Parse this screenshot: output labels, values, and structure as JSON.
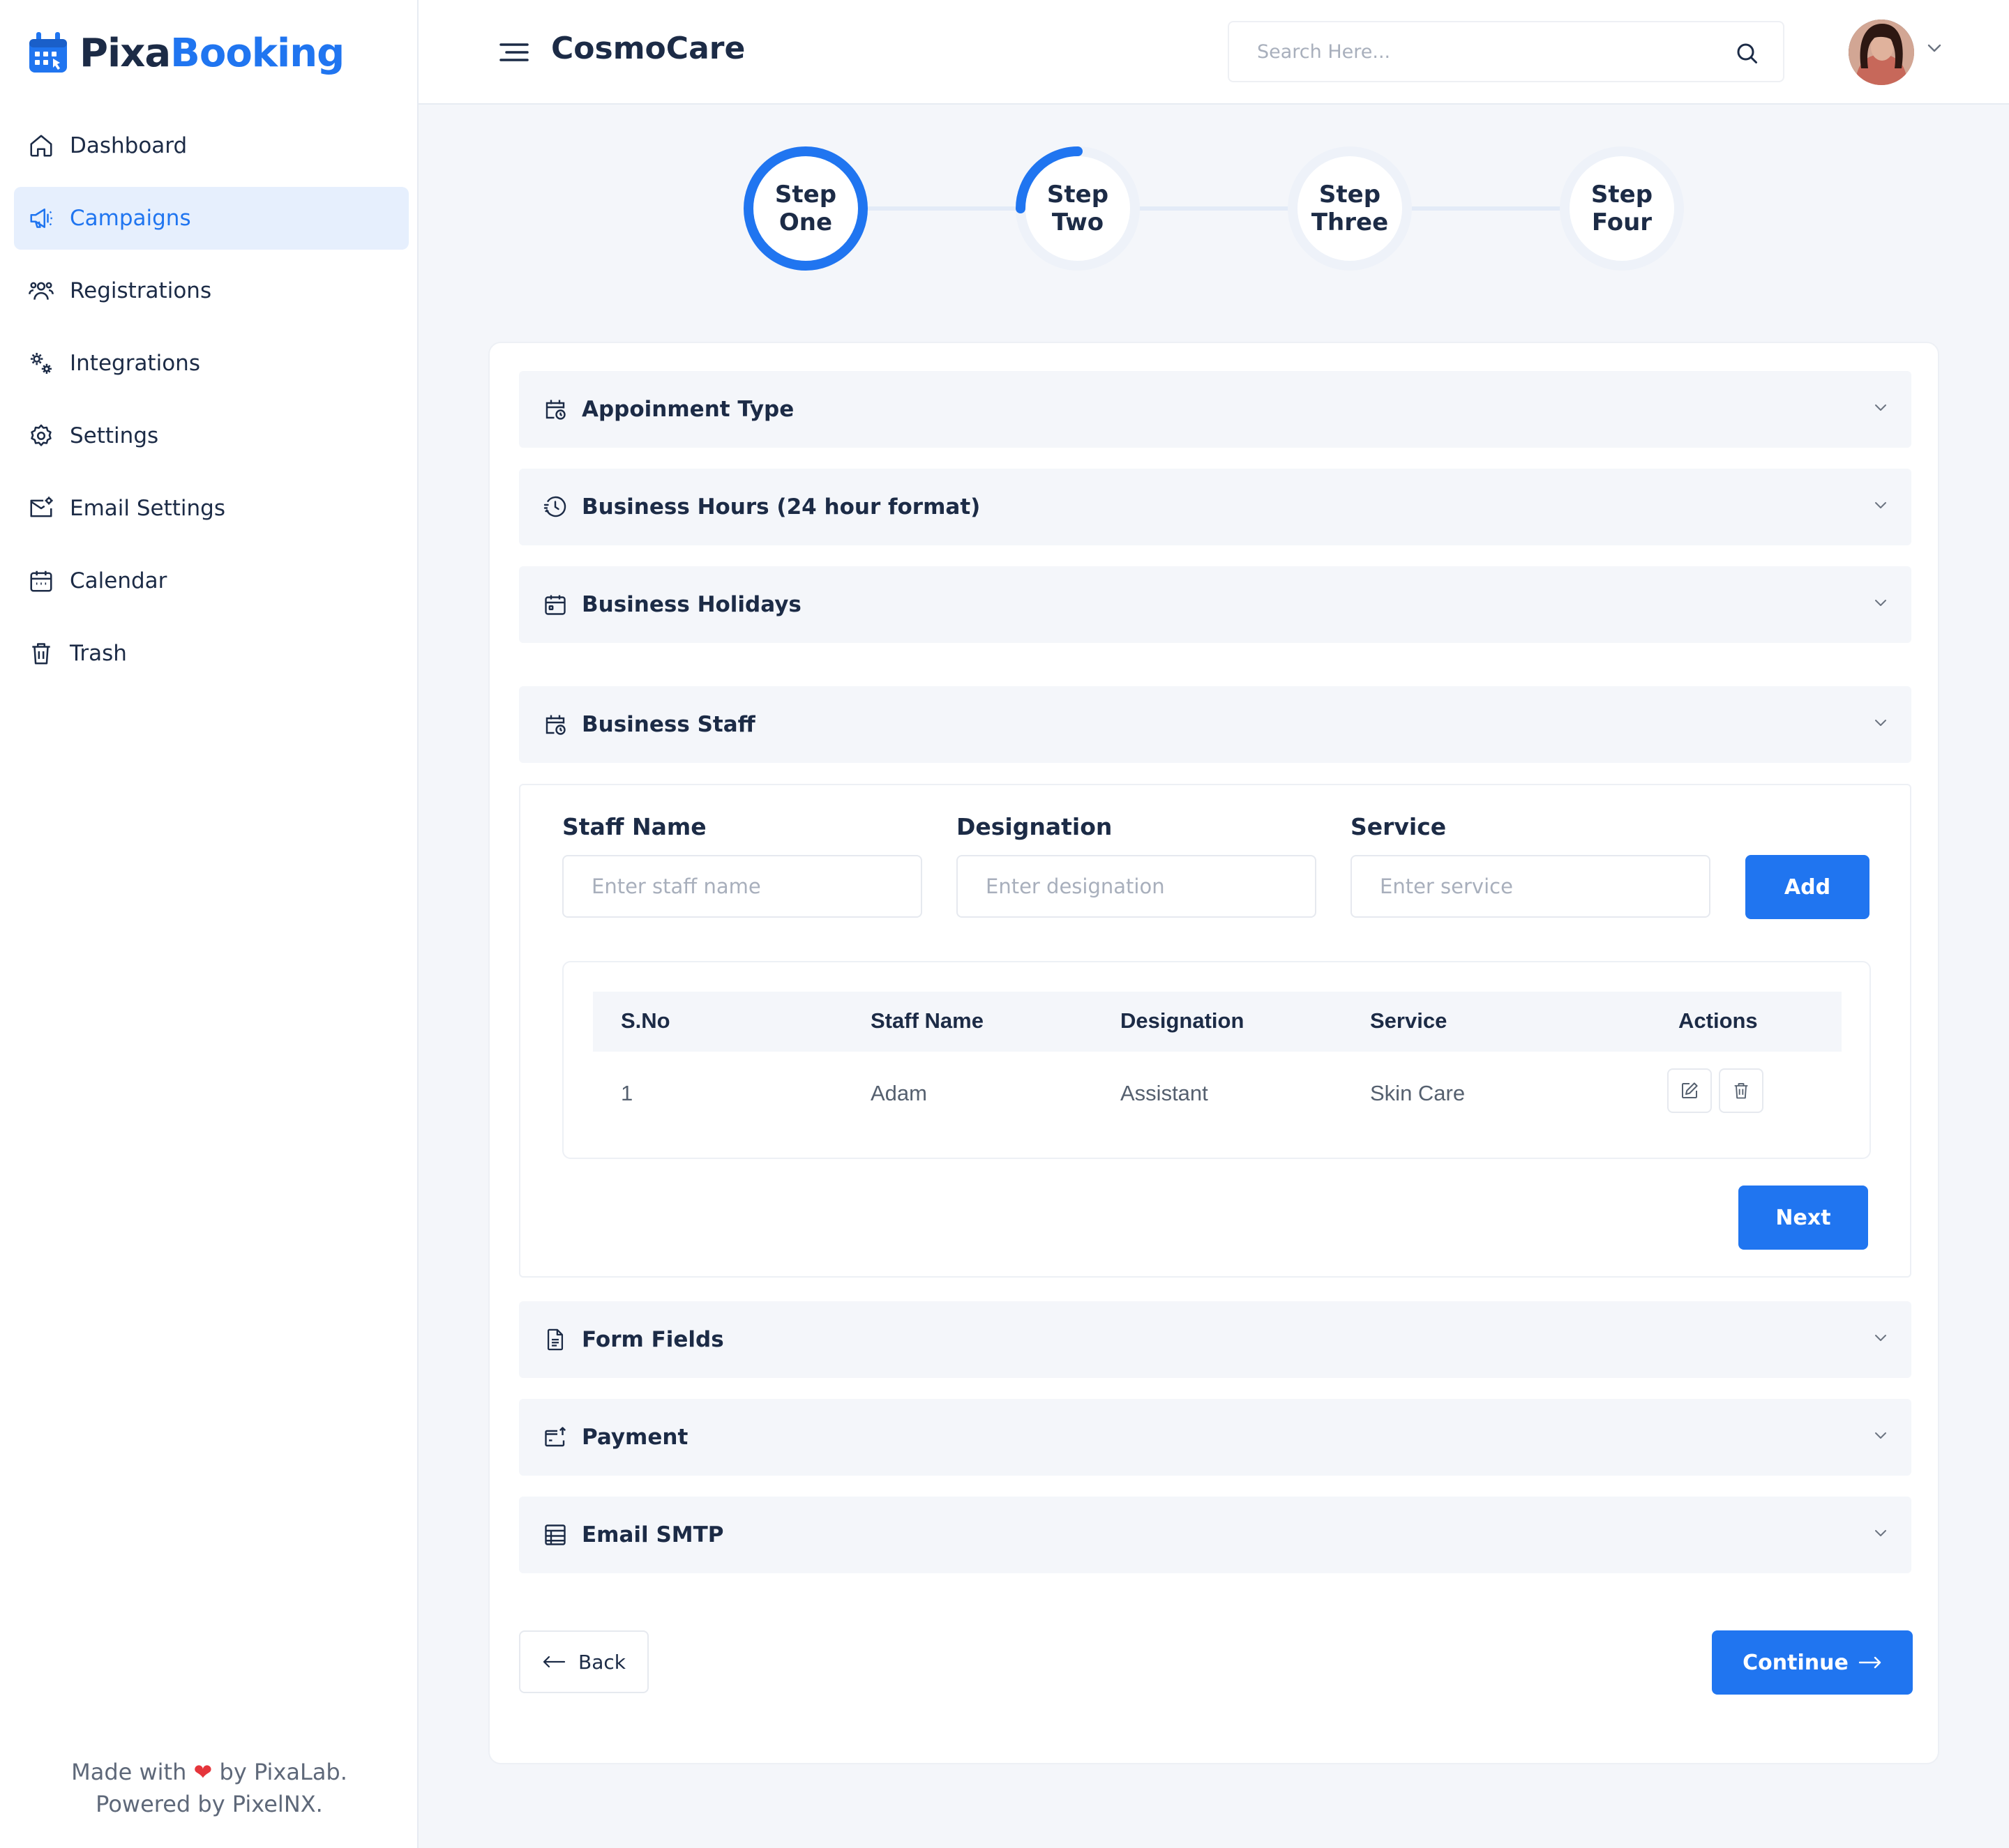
{
  "app": {
    "logo_part1": "Pixa",
    "logo_part2": "Booking",
    "brand_color": "#2075f0"
  },
  "sidebar": {
    "items": [
      {
        "label": "Dashboard",
        "icon": "home-icon"
      },
      {
        "label": "Campaigns",
        "icon": "megaphone-icon",
        "active": true
      },
      {
        "label": "Registrations",
        "icon": "users-icon"
      },
      {
        "label": "Integrations",
        "icon": "gears-icon"
      },
      {
        "label": "Settings",
        "icon": "gear-icon"
      },
      {
        "label": "Email Settings",
        "icon": "mail-settings-icon"
      },
      {
        "label": "Calendar",
        "icon": "calendar-icon"
      },
      {
        "label": "Trash",
        "icon": "trash-icon"
      }
    ],
    "footer_line1_a": "Made with",
    "footer_line1_b": "by PixaLab.",
    "footer_line2": "Powered by PixelNX."
  },
  "header": {
    "title": "CosmoCare",
    "search_placeholder": "Search Here..."
  },
  "steps": [
    {
      "line1": "Step",
      "line2": "One",
      "progress": 1.0
    },
    {
      "line1": "Step",
      "line2": "Two",
      "progress": 0.25
    },
    {
      "line1": "Step",
      "line2": "Three",
      "progress": 0
    },
    {
      "line1": "Step",
      "line2": "Four",
      "progress": 0
    }
  ],
  "accordions": {
    "appointment_type": "Appoinment Type",
    "business_hours": "Business Hours (24 hour format)",
    "business_holidays": "Business Holidays",
    "business_staff": "Business Staff",
    "form_fields": "Form Fields",
    "payment": "Payment",
    "email_smtp": "Email SMTP"
  },
  "staff_form": {
    "name_label": "Staff Name",
    "name_placeholder": "Enter staff name",
    "designation_label": "Designation",
    "designation_placeholder": "Enter designation",
    "service_label": "Service",
    "service_placeholder": "Enter service",
    "add_label": "Add",
    "next_label": "Next"
  },
  "staff_table": {
    "columns": [
      "S.No",
      "Staff Name",
      "Designation",
      "Service",
      "Actions"
    ],
    "rows": [
      {
        "sno": "1",
        "name": "Adam",
        "designation": "Assistant",
        "service": "Skin Care"
      }
    ]
  },
  "footer_actions": {
    "back_label": "Back",
    "continue_label": "Continue"
  }
}
